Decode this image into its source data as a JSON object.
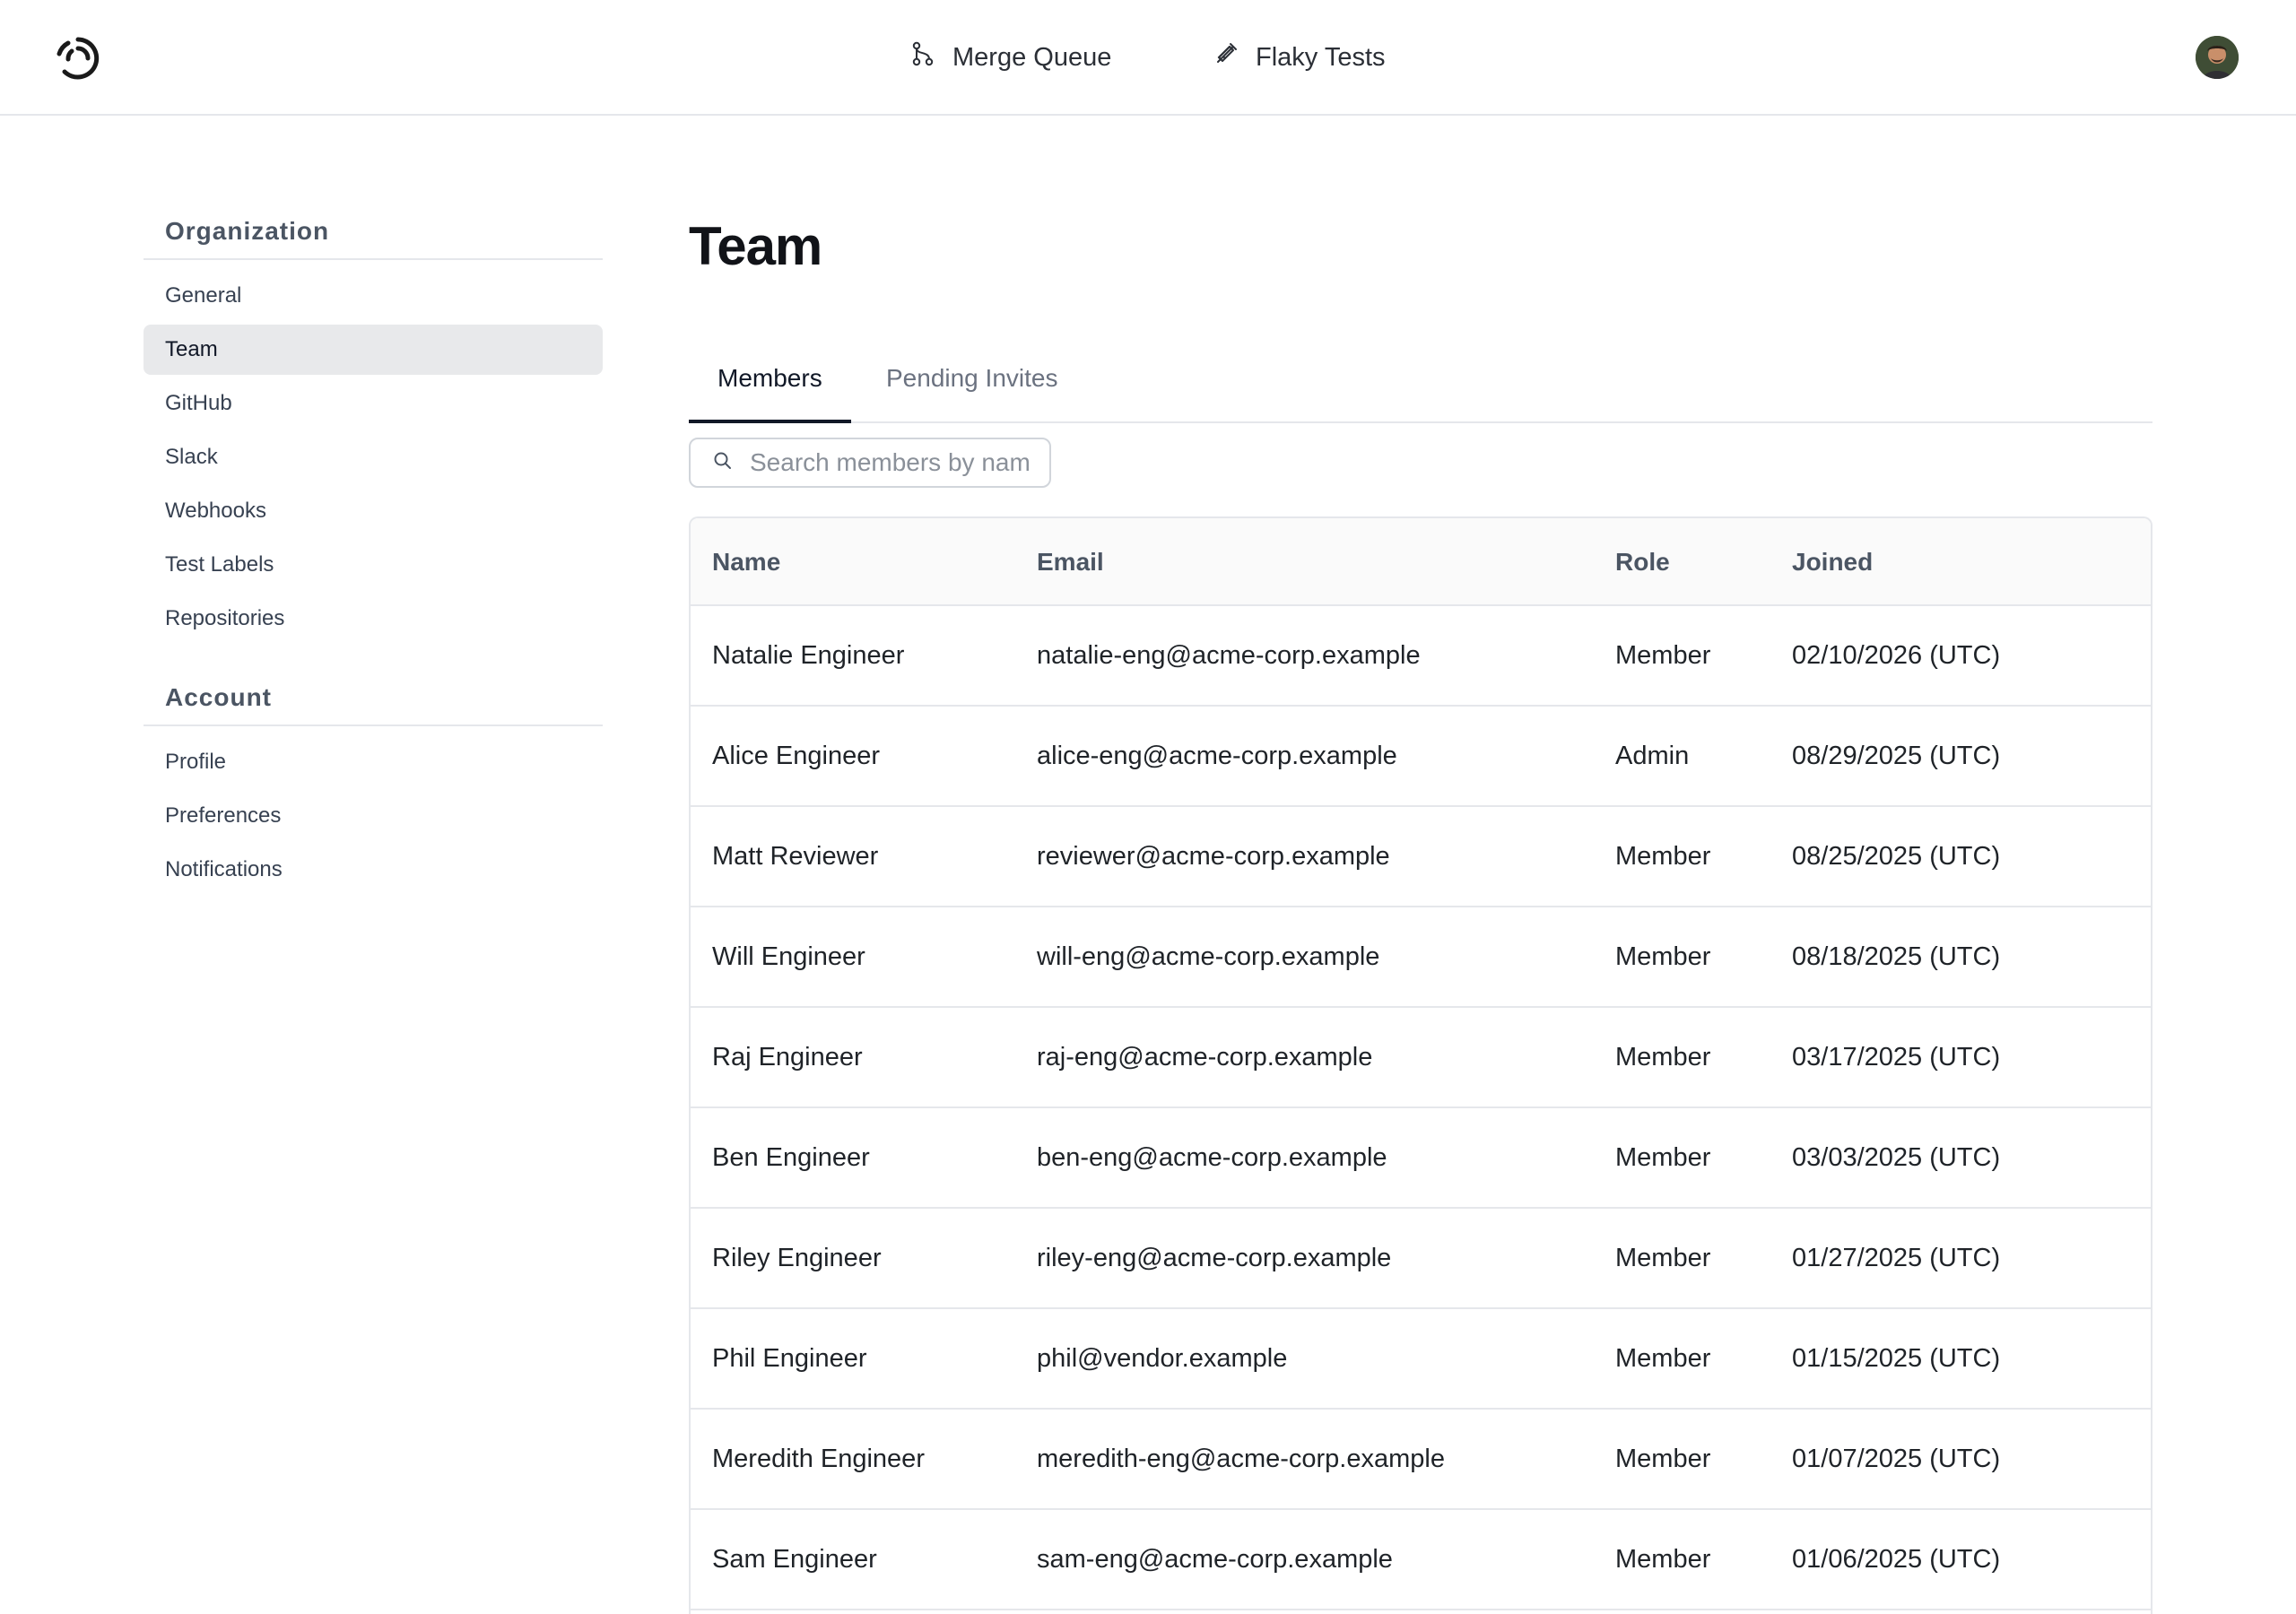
{
  "topbar": {
    "nav": [
      {
        "label": "Merge Queue",
        "icon": "git-merge-icon"
      },
      {
        "label": "Flaky Tests",
        "icon": "syringe-icon"
      }
    ]
  },
  "sidebar": {
    "sections": [
      {
        "title": "Organization",
        "items": [
          "General",
          "Team",
          "GitHub",
          "Slack",
          "Webhooks",
          "Test Labels",
          "Repositories"
        ]
      },
      {
        "title": "Account",
        "items": [
          "Profile",
          "Preferences",
          "Notifications"
        ]
      }
    ],
    "active_item": "Team"
  },
  "main": {
    "title": "Team",
    "tabs": [
      {
        "label": "Members",
        "active": true
      },
      {
        "label": "Pending Invites",
        "active": false
      }
    ],
    "search": {
      "placeholder": "Search members by name",
      "value": ""
    },
    "table": {
      "columns": [
        "Name",
        "Email",
        "Role",
        "Joined"
      ],
      "rows": [
        [
          "Natalie Engineer",
          "natalie-eng@acme-corp.example",
          "Member",
          "02/10/2026 (UTC)"
        ],
        [
          "Alice Engineer",
          "alice-eng@acme-corp.example",
          "Admin",
          "08/29/2025 (UTC)"
        ],
        [
          "Matt Reviewer",
          "reviewer@acme-corp.example",
          "Member",
          "08/25/2025 (UTC)"
        ],
        [
          "Will Engineer",
          "will-eng@acme-corp.example",
          "Member",
          "08/18/2025 (UTC)"
        ],
        [
          "Raj Engineer",
          "raj-eng@acme-corp.example",
          "Member",
          "03/17/2025 (UTC)"
        ],
        [
          "Ben Engineer",
          "ben-eng@acme-corp.example",
          "Member",
          "03/03/2025 (UTC)"
        ],
        [
          "Riley Engineer",
          "riley-eng@acme-corp.example",
          "Member",
          "01/27/2025 (UTC)"
        ],
        [
          "Phil Engineer",
          "phil@vendor.example",
          "Member",
          "01/15/2025 (UTC)"
        ],
        [
          "Meredith Engineer",
          "meredith-eng@acme-corp.example",
          "Member",
          "01/07/2025 (UTC)"
        ],
        [
          "Sam Engineer",
          "sam-eng@acme-corp.example",
          "Member",
          "01/06/2025 (UTC)"
        ]
      ]
    }
  },
  "colors": {
    "active_item_bg": "#e8e9eb",
    "border": "#e5e7eb",
    "text": "#1f2328",
    "muted": "#6b7280"
  }
}
